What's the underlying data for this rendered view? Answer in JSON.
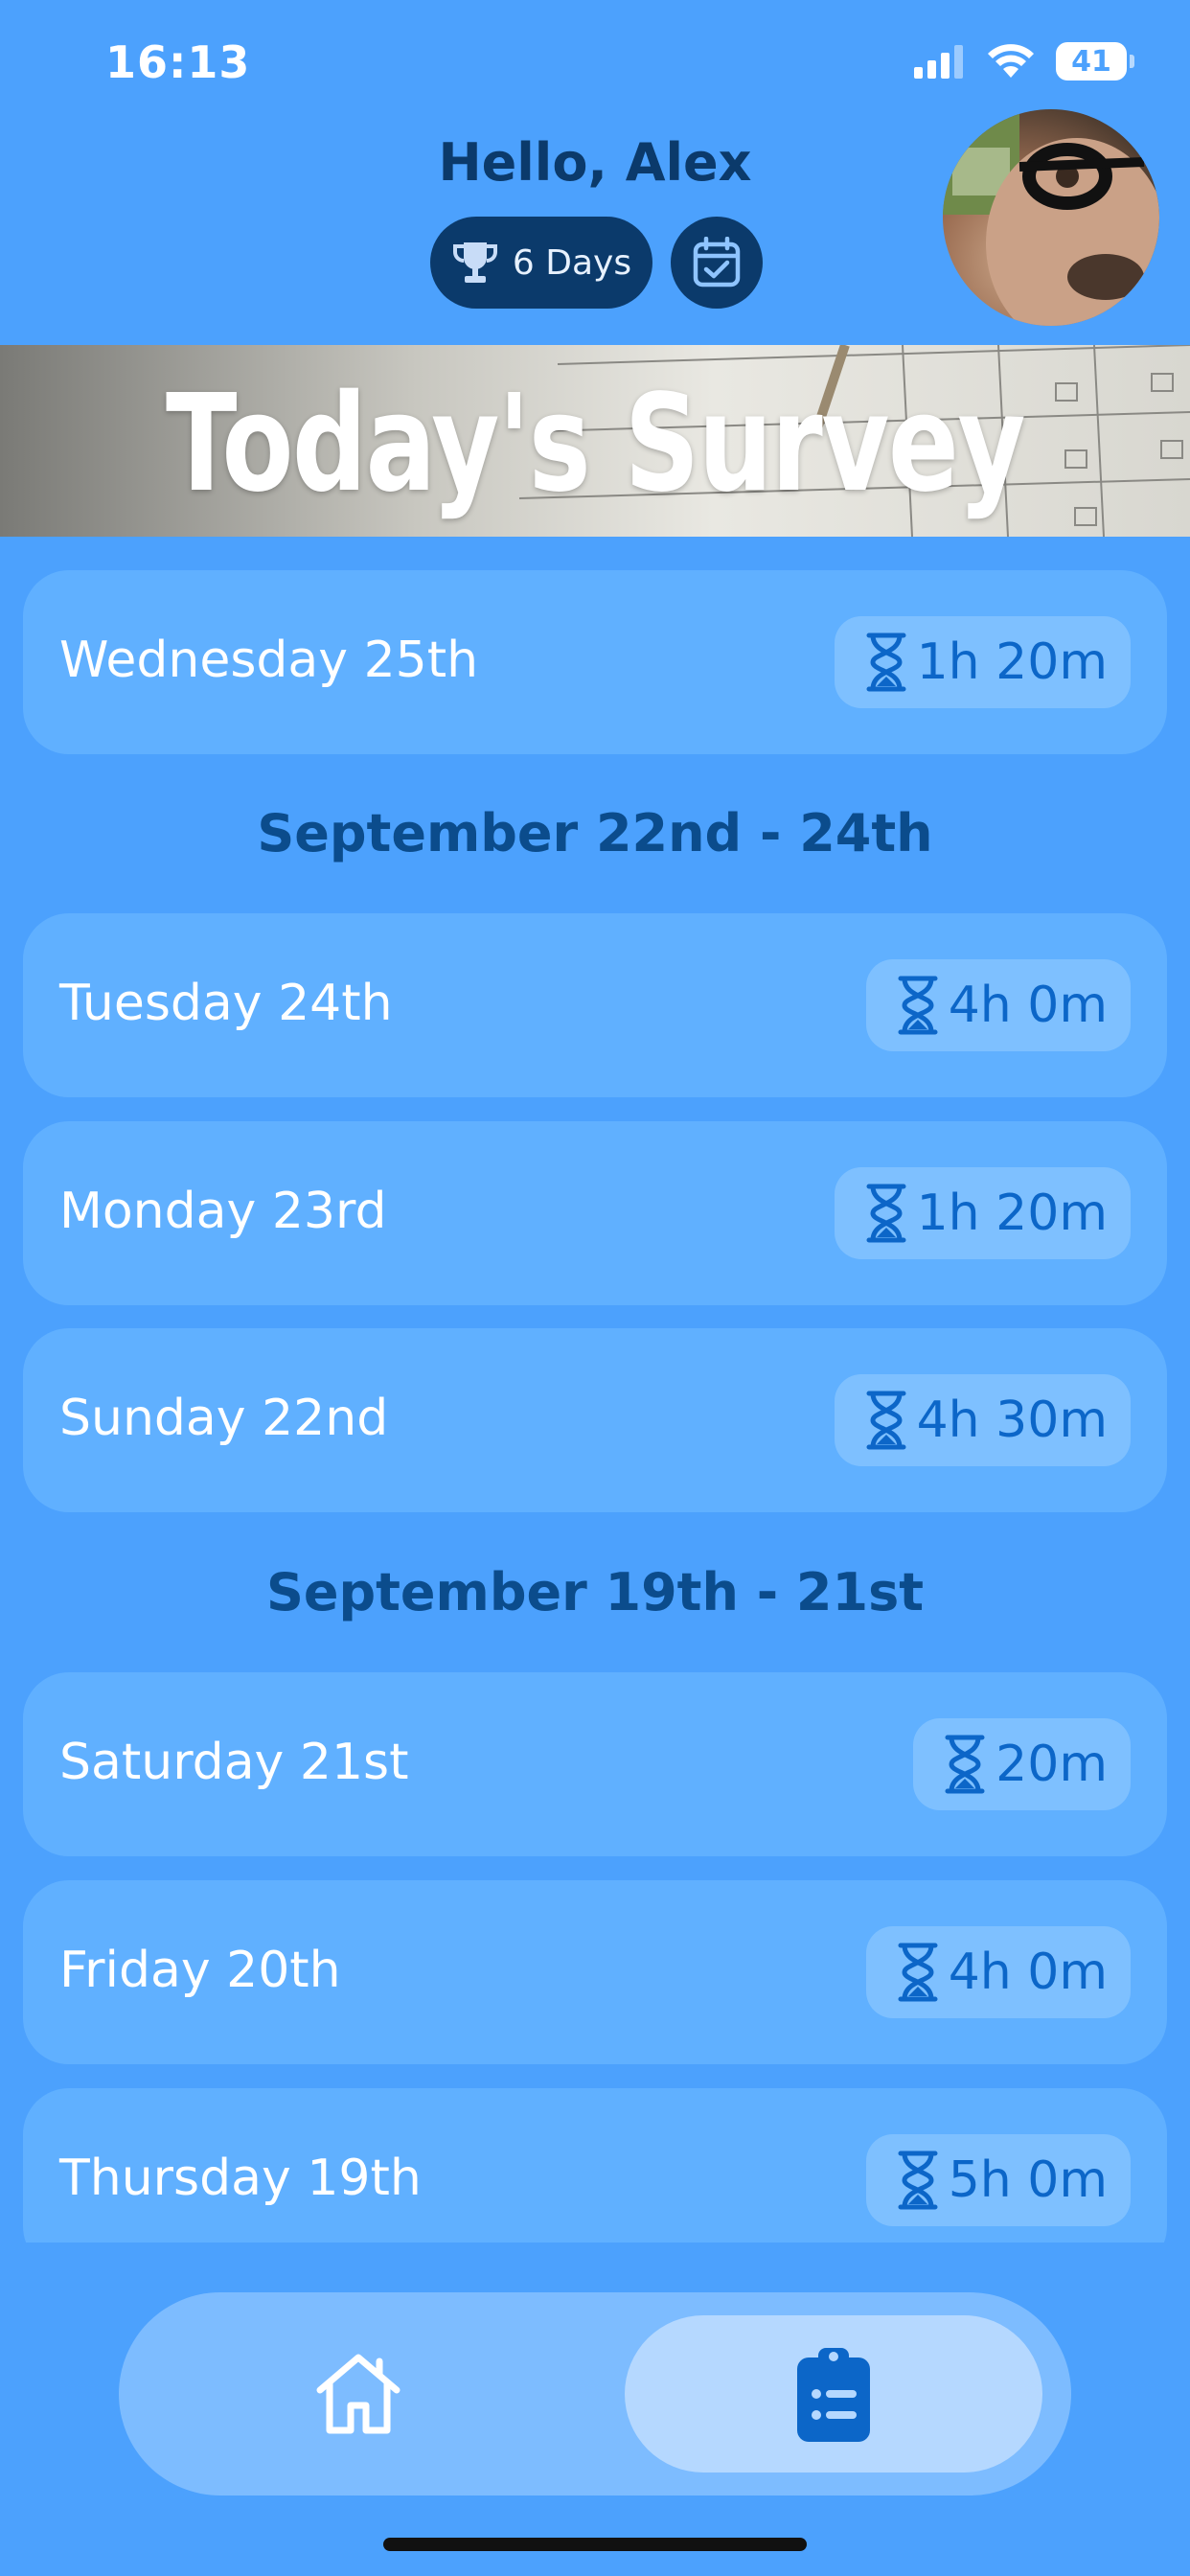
{
  "status_bar": {
    "time": "16:13",
    "battery": "41"
  },
  "header": {
    "greeting": "Hello, Alex",
    "streak": "6 Days"
  },
  "banner": {
    "title": "Today's Survey"
  },
  "list": {
    "top_item": {
      "label": "Wednesday 25th",
      "duration": "1h 20m"
    },
    "sections": [
      {
        "title": "September 22nd - 24th",
        "items": [
          {
            "label": "Tuesday 24th",
            "duration": "4h 0m"
          },
          {
            "label": "Monday 23rd",
            "duration": "1h 20m"
          },
          {
            "label": "Sunday 22nd",
            "duration": "4h 30m"
          }
        ]
      },
      {
        "title": "September 19th - 21st",
        "items": [
          {
            "label": "Saturday 21st",
            "duration": "20m"
          },
          {
            "label": "Friday 20th",
            "duration": "4h 0m"
          },
          {
            "label": "Thursday 19th",
            "duration": "5h 0m"
          }
        ]
      }
    ]
  },
  "colors": {
    "background": "#4ca1fd",
    "card": "#60b0ff",
    "badge": "#7ec0ff",
    "badge_text": "#0c66c8",
    "dark": "#0b3a6b",
    "nav": "#7dbcff",
    "nav_active": "#b5d8ff"
  },
  "icons": {
    "trophy": "trophy-icon",
    "calendar": "calendar-check-icon",
    "hourglass": "hourglass-icon",
    "home": "home-icon",
    "survey": "clipboard-list-icon"
  }
}
